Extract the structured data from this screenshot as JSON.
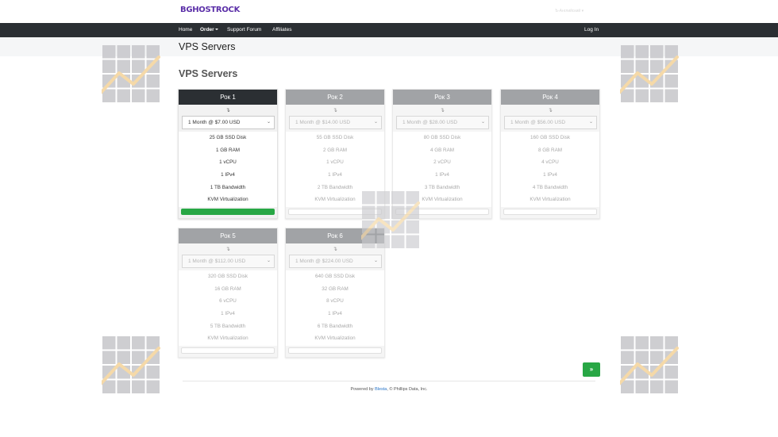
{
  "header": {
    "logo_text": "BGHOSTROCK",
    "language_selector": "Ъ-Английский"
  },
  "nav": {
    "items": [
      {
        "label": "Home"
      },
      {
        "label": "Order"
      },
      {
        "label": "Support Forum"
      },
      {
        "label": "Affiliates"
      }
    ],
    "login_label": "Log In"
  },
  "page": {
    "title": "VPS Servers",
    "section_heading": "VPS Servers"
  },
  "packages": [
    {
      "name": "Рок 1",
      "option": "1 Month @ $7.00 USD",
      "specs": [
        "25 GB SSD Disk",
        "1 GB RAM",
        "1 vCPU",
        "1 IPv4",
        "1 TB Bandwidth",
        "KVM Virtualization"
      ],
      "selected": true
    },
    {
      "name": "Рок 2",
      "option": "1 Month @ $14.00 USD",
      "specs": [
        "55 GB SSD Disk",
        "2 GB RAM",
        "1 vCPU",
        "1 IPv4",
        "2 TB Bandwidth",
        "KVM Virtualization"
      ],
      "selected": false
    },
    {
      "name": "Рок 3",
      "option": "1 Month @ $28.00 USD",
      "specs": [
        "80 GB SSD Disk",
        "4 GB RAM",
        "2 vCPU",
        "1 IPv4",
        "3 TB Bandwidth",
        "KVM Virtualization"
      ],
      "selected": false
    },
    {
      "name": "Рок 4",
      "option": "1 Month @ $56.00 USD",
      "specs": [
        "160 GB SSD Disk",
        "8 GB RAM",
        "4 vCPU",
        "1 IPv4",
        "4 TB Bandwidth",
        "KVM Virtualization"
      ],
      "selected": false
    },
    {
      "name": "Рок 5",
      "option": "1 Month @ $112.00 USD",
      "specs": [
        "320 GB SSD Disk",
        "16 GB RAM",
        "6 vCPU",
        "1 IPv4",
        "5 TB Bandwidth",
        "KVM Virtualization"
      ],
      "selected": false
    },
    {
      "name": "Рок 6",
      "option": "1 Month @ $224.00 USD",
      "specs": [
        "640 GB SSD Disk",
        "32 GB RAM",
        "8 vCPU",
        "1 IPv4",
        "6 TB Bandwidth",
        "KVM Virtualization"
      ],
      "selected": false
    }
  ],
  "next_button": {
    "label": "»"
  },
  "footer": {
    "prefix": "Powered by",
    "link": "Blesta",
    "suffix": ", © Phillips Data, Inc."
  },
  "colors": {
    "navbar": "#2b2f33",
    "active_header": "#2b2f33",
    "inactive_header": "#7d8085",
    "selected_bar": "#28a745",
    "logo": "#5b2fa8"
  }
}
